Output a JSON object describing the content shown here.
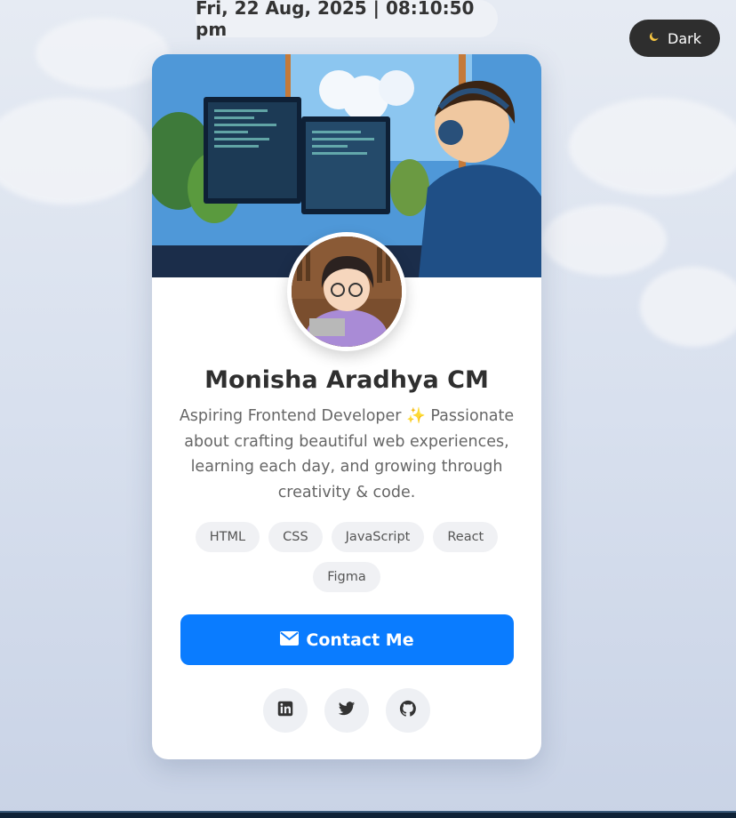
{
  "header": {
    "datetime": "Fri, 22 Aug, 2025 | 08:10:50 pm"
  },
  "theme_toggle": {
    "icon": "moon-icon",
    "label": "Dark"
  },
  "profile": {
    "name": "Monisha Aradhya CM",
    "bio": "Aspiring Frontend Developer ✨ Passionate about crafting beautiful web experiences, learning each day, and growing through creativity & code.",
    "skills": [
      "HTML",
      "CSS",
      "JavaScript",
      "React",
      "Figma"
    ]
  },
  "contact": {
    "label": "Contact Me",
    "icon": "envelope-icon"
  },
  "socials": [
    {
      "icon": "linkedin-icon"
    },
    {
      "icon": "twitter-icon"
    },
    {
      "icon": "github-icon"
    }
  ],
  "colors": {
    "accent": "#0a7cff",
    "toggle_bg": "#2e2e2e",
    "chip_bg": "#f0f1f4"
  }
}
